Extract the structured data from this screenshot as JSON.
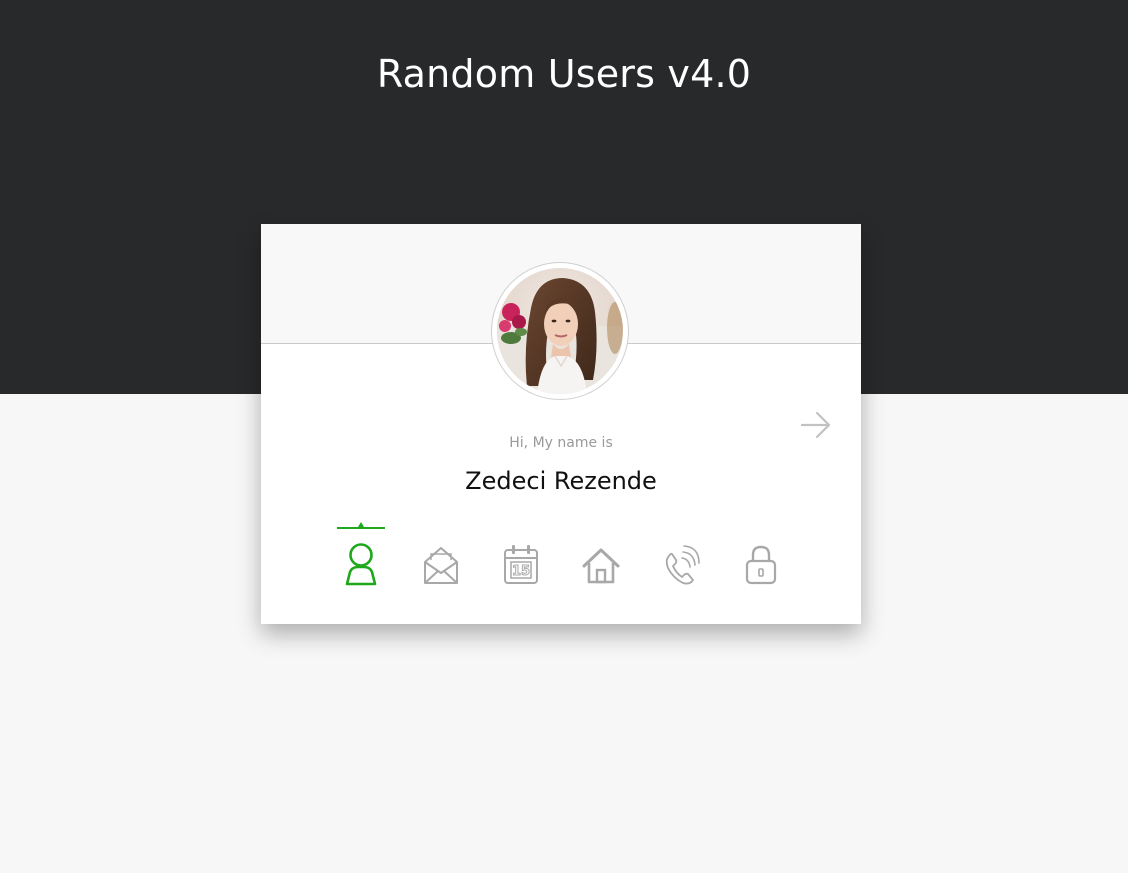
{
  "page": {
    "title": "Random Users v4.0"
  },
  "card": {
    "greeting": "Hi, My name is",
    "name": "Zedeci Rezende",
    "next_icon": "arrow-right-icon",
    "tabs": [
      {
        "icon": "user-icon",
        "active": true
      },
      {
        "icon": "envelope-icon",
        "active": false
      },
      {
        "icon": "calendar-icon",
        "active": false,
        "glyph": "15"
      },
      {
        "icon": "home-icon",
        "active": false
      },
      {
        "icon": "phone-icon",
        "active": false
      },
      {
        "icon": "lock-icon",
        "active": false
      }
    ]
  },
  "colors": {
    "header_background": "#28292b",
    "page_background": "#f7f7f7",
    "accent": "#1fa81b",
    "icon_inactive": "#a8a8a8"
  }
}
